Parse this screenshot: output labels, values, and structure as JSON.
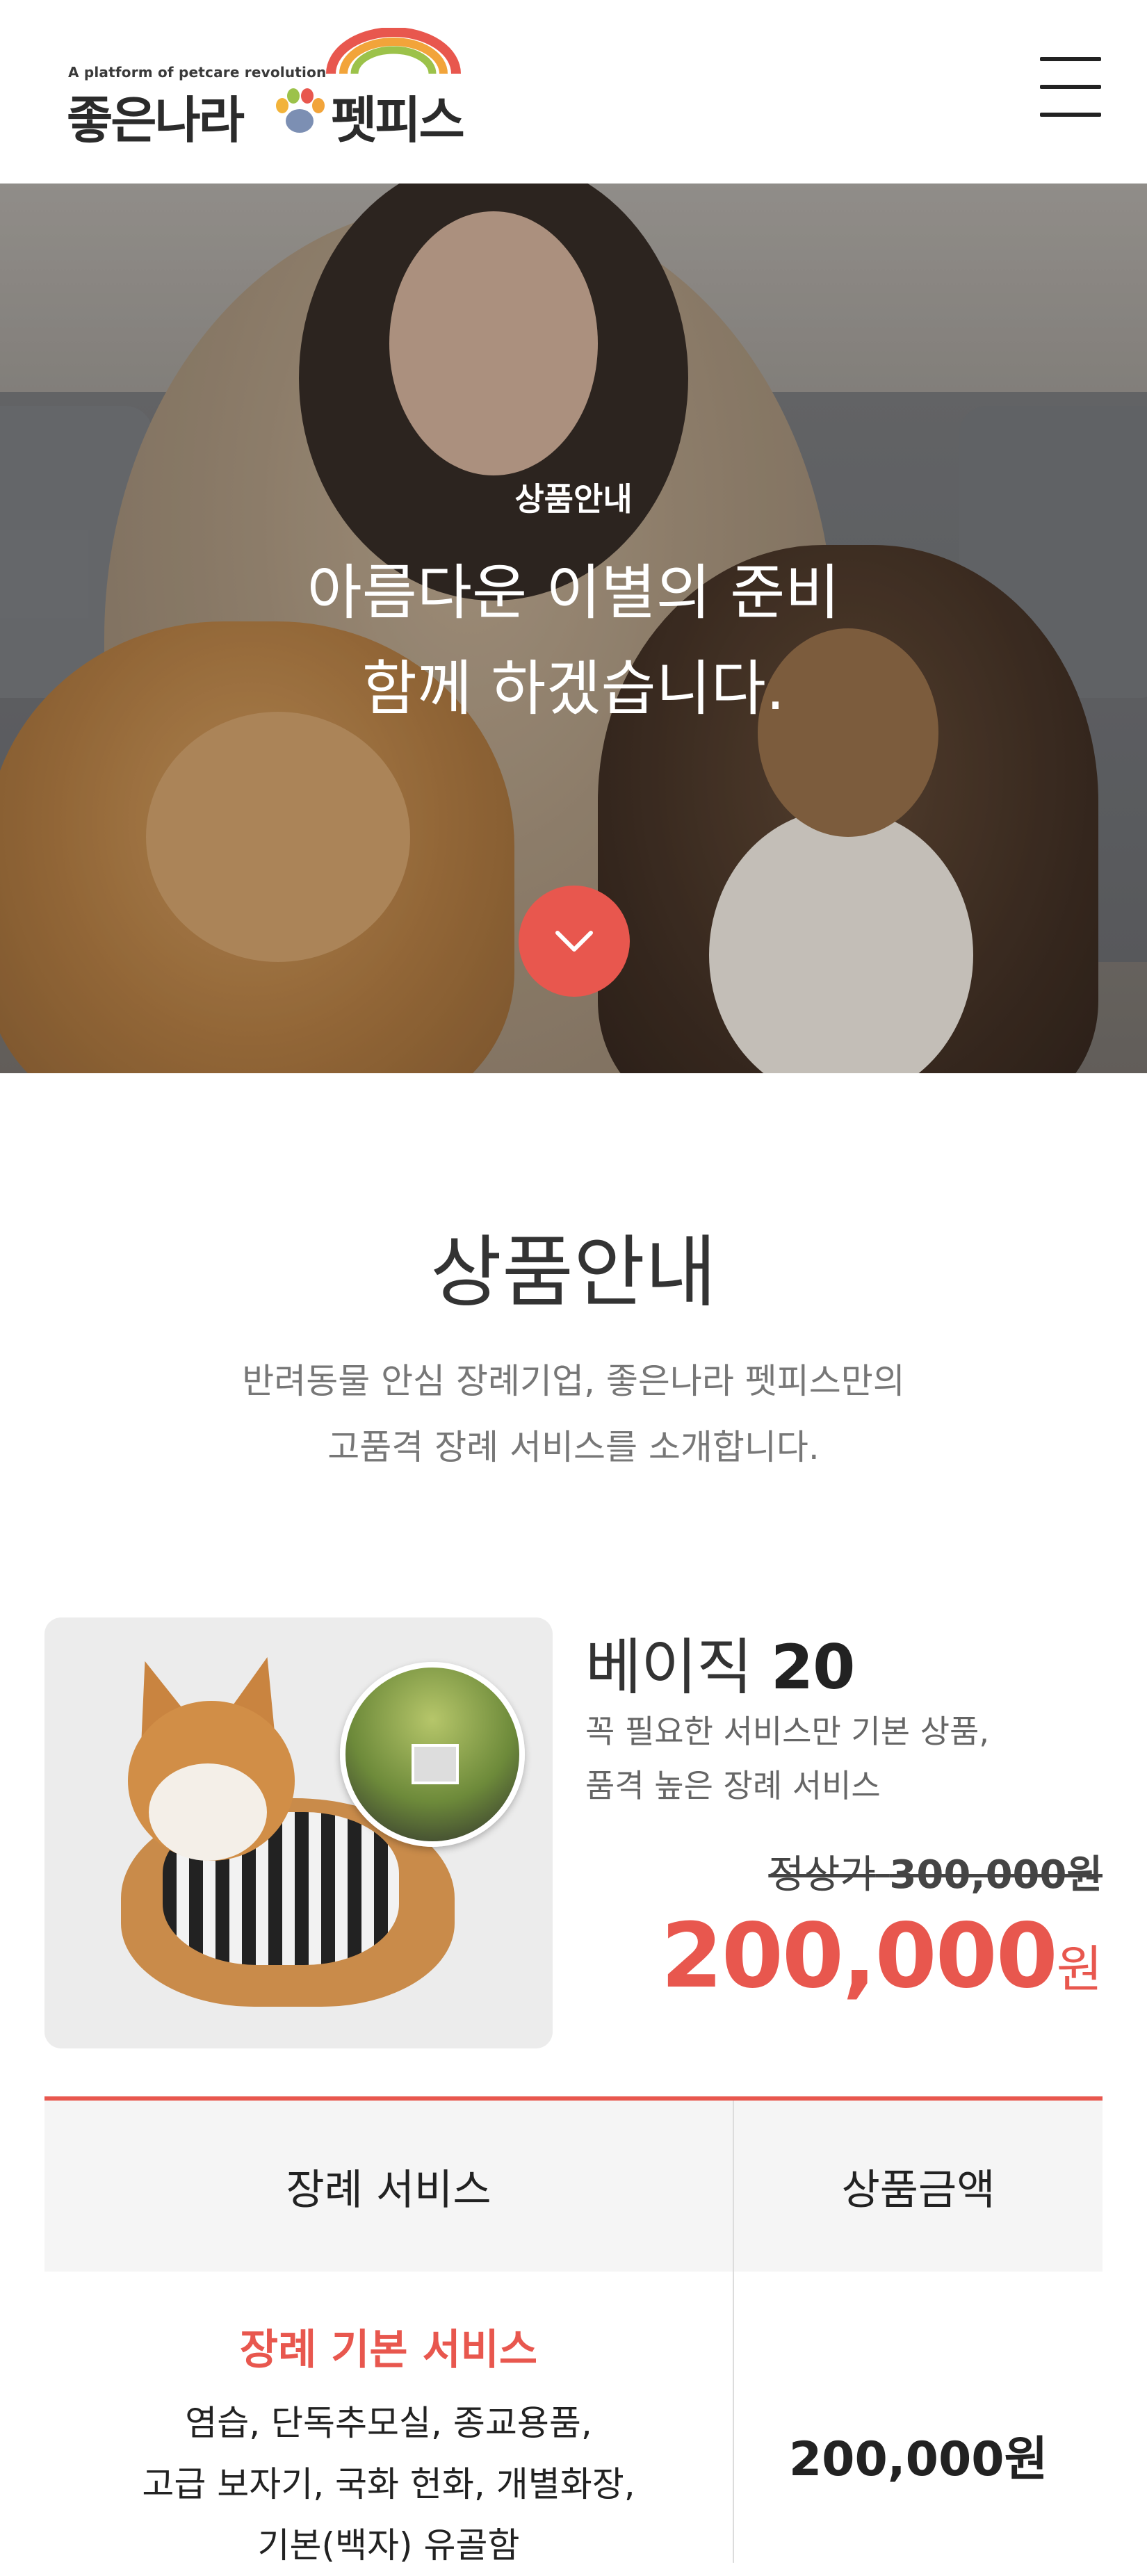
{
  "header": {
    "tagline": "A platform of petcare revolution",
    "brand_left": "좋은나라",
    "brand_right": "펫피스",
    "menu_icon": "hamburger-menu-icon"
  },
  "hero": {
    "label": "상품안내",
    "title_line1": "아름다운 이별의 준비",
    "title_line2": "함께 하겠습니다.",
    "scroll_icon": "chevron-down-icon"
  },
  "intro": {
    "title": "상품안내",
    "desc_line1": "반려동물 안심 장례기업, 좋은나라 펫피스만의",
    "desc_line2": "고품격 장례 서비스를 소개합니다."
  },
  "product": {
    "name": "베이직",
    "name_num": "20",
    "desc_line1": "꼭 필요한 서비스만 기본 상품,",
    "desc_line2": "품격 높은 장례 서비스",
    "orig_label": "정상가",
    "orig_price": "300,000원",
    "price": "200,000",
    "price_unit": "원"
  },
  "table": {
    "header_service": "장례 서비스",
    "header_price": "상품금액",
    "row_title": "장례 기본 서비스",
    "row_desc_line1": "염습, 단독추모실, 종교용품,",
    "row_desc_line2": "고급 보자기, 국화 헌화, 개별화장,",
    "row_desc_line3": "기본(백자) 유골함",
    "row_price": "200,000원"
  },
  "colors": {
    "accent": "#e8574e",
    "text_dark": "#222222",
    "text_muted": "#777777",
    "table_header_bg": "#f5f5f5"
  }
}
